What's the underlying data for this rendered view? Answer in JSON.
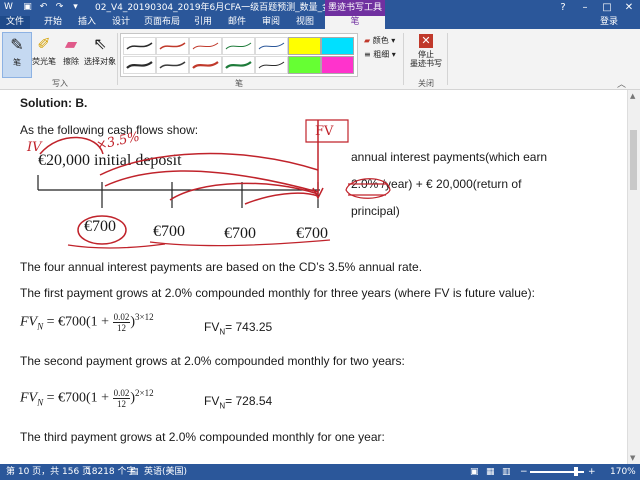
{
  "titlebar": {
    "doc_title": "02_V4_20190304_2019年6月CFA一级百题预测_数量_金程教育...",
    "context_tab": "墨迹书写工具"
  },
  "menu": {
    "file": "文件",
    "items": [
      "开始",
      "插入",
      "设计",
      "页面布局",
      "引用",
      "邮件",
      "审阅",
      "视图"
    ],
    "active": "笔",
    "login": "登录"
  },
  "ribbon": {
    "buttons": [
      "笔",
      "荧光笔",
      "擦除",
      "选择对象"
    ],
    "group_write": "写入",
    "group_pens": "笔",
    "pen_color": "颜色",
    "pen_weight": "粗细",
    "stop": "停止\n墨迹书写",
    "group_close": "关闭",
    "pen_colors": [
      "#2b2b2b",
      "#c0392b",
      "#c0392b",
      "#1e7b3a",
      "#2b579a",
      "#5b5b5b",
      "#2b2b2b",
      "#3b3b3b",
      "#c0392b",
      "#1e7b3a",
      "#2b579a",
      "#2b2b2b"
    ],
    "highlighter_colors": [
      "#ffff00",
      "#00e0ff",
      "#66ff33",
      "#ff33cc"
    ]
  },
  "document": {
    "solution": "Solution: B.",
    "intro": "As the following cash flows show:",
    "deposit": "€20,000 initial deposit",
    "annual1": "annual interest payments(which earn",
    "annual2": "2.0% /year) +  € 20,000(return of",
    "annual3": "principal)",
    "payments": [
      "€700",
      "€700",
      "€700",
      "€700"
    ],
    "p1": "The four annual interest payments are based on the CD’s 3.5% annual rate.",
    "p2": "The first payment grows at 2.0% compounded monthly for three years (where FV is future value):",
    "p3": "The second payment grows at 2.0% compounded monthly for two years:",
    "p4": "The third payment grows at 2.0% compounded monthly for one year:",
    "eq1_lhs": "FV",
    "eq_sub": "N",
    "eq_eq": "=  €700(1 +",
    "frac_num": "0.02",
    "frac_den": "12",
    "eq1_exp": "3×12",
    "eq2_exp": "2×12",
    "res1_label": "FV",
    "res1_val": "= 743.25",
    "res2_val": "= 728.54",
    "ink": {
      "iv": "IV",
      "x35": "×3.5%",
      "fv": "FV"
    }
  },
  "status": {
    "page": "第 10 页，共 156 页",
    "words": "18218 个字",
    "lang": "英语(美国)",
    "zoom": "170%"
  }
}
